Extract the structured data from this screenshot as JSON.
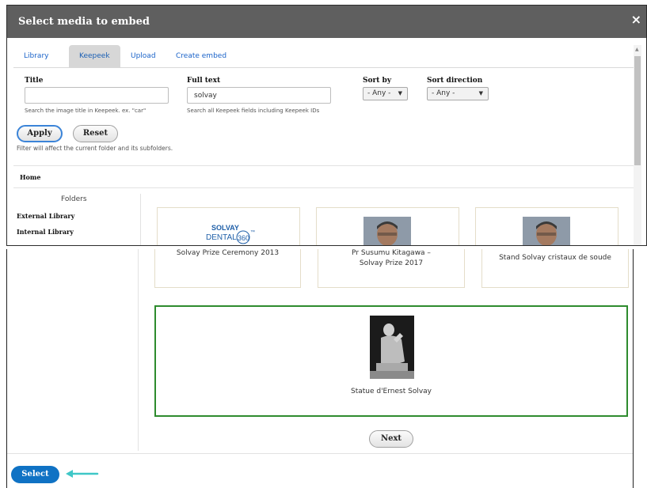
{
  "dialog": {
    "title": "Select media to embed",
    "close_glyph": "×"
  },
  "tabs": [
    {
      "label": "Library",
      "active": false
    },
    {
      "label": "Keepeek",
      "active": true
    },
    {
      "label": "Upload",
      "active": false
    },
    {
      "label": "Create embed",
      "active": false
    }
  ],
  "filters": {
    "title": {
      "label": "Title",
      "value": "",
      "help": "Search the image title in Keepeek. ex. \"car\""
    },
    "full_text": {
      "label": "Full text",
      "value": "solvay",
      "help": "Search all Keepeek fields including Keepeek IDs"
    },
    "sort_by": {
      "label": "Sort by",
      "value": "- Any -"
    },
    "sort_direction": {
      "label": "Sort direction",
      "value": "- Any -"
    },
    "apply_label": "Apply",
    "reset_label": "Reset",
    "note": "Filter will affect the current folder and its subfolders."
  },
  "breadcrumb": {
    "home": "Home"
  },
  "sidebar": {
    "heading": "Folders",
    "items": [
      "External Library",
      "Internal Library"
    ]
  },
  "logo": {
    "top": "SOLVAY",
    "bottom": "DENTAL",
    "badge": "360",
    "tm": "™"
  },
  "results": {
    "row1": [
      {
        "caption": "Solvay Prize Ceremony 2013"
      },
      {
        "caption": "Pr Susumu Kitagawa – Solvay Prize 2017"
      },
      {
        "caption": "Stand Solvay cristaux de soude"
      }
    ],
    "selected": {
      "caption": "Statue d'Ernest Solvay"
    }
  },
  "pager": {
    "next_label": "Next"
  },
  "footer": {
    "select_label": "Select"
  },
  "colors": {
    "titlebar": "#5f5f5f",
    "link": "#1a63c9",
    "selected_border": "#2e8b2e",
    "select_button": "#0f72c4",
    "annotation_arrow": "#3fc7c7",
    "logo_blue": "#1f5fa8"
  },
  "icons": {
    "close": "close-icon",
    "dropdown": "chevron-down-icon",
    "annotation": "arrow-left-icon"
  }
}
